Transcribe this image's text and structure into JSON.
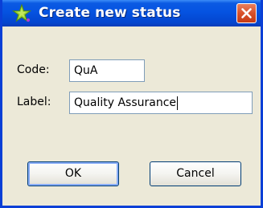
{
  "window": {
    "title": "Create new status",
    "icon": "green-star-icon",
    "close_icon": "close-icon"
  },
  "form": {
    "code_label": "Code:",
    "code_value": "QuA",
    "label_label": "Label:",
    "label_value": "Quality Assurance"
  },
  "buttons": {
    "ok_label": "OK",
    "cancel_label": "Cancel"
  },
  "colors": {
    "titlebar": "#0553e1",
    "close_button": "#d9512a",
    "dialog_background": "#ece9d8",
    "field_border": "#7f9db9"
  }
}
